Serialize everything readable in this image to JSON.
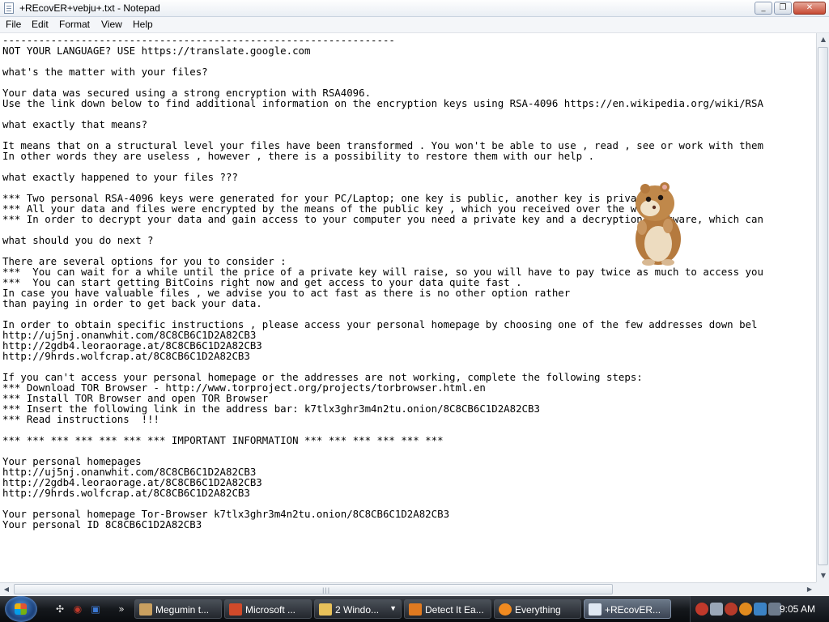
{
  "window": {
    "title": "+REcovER+vebju+.txt - Notepad",
    "minimize_glyph": "_",
    "maximize_glyph": "❐",
    "close_glyph": "✕"
  },
  "menu": [
    "File",
    "Edit",
    "Format",
    "View",
    "Help"
  ],
  "document": {
    "lines": [
      "-----------------------------------------------------------------",
      "NOT YOUR LANGUAGE? USE https://translate.google.com",
      "",
      "what's the matter with your files?",
      "",
      "Your data was secured using a strong encryption with RSA4096.",
      "Use the link down below to find additional information on the encryption keys using RSA-4096 https://en.wikipedia.org/wiki/RSA",
      "",
      "what exactly that means?",
      "",
      "It means that on a structural level your files have been transformed . You won't be able to use , read , see or work with them",
      "In other words they are useless , however , there is a possibility to restore them with our help .",
      "",
      "what exactly happened to your files ???",
      "",
      "*** Two personal RSA-4096 keys were generated for your PC/Laptop; one key is public, another key is private.",
      "*** All your data and files were encrypted by the means of the public key , which you received over the web .",
      "*** In order to decrypt your data and gain access to your computer you need a private key and a decryption software, which can",
      "",
      "what should you do next ?",
      "",
      "There are several options for you to consider :",
      "***  You can wait for a while until the price of a private key will raise, so you will have to pay twice as much to access you",
      "***  You can start getting BitCoins right now and get access to your data quite fast .",
      "In case you have valuable files , we advise you to act fast as there is no other option rather",
      "than paying in order to get back your data.",
      "",
      "In order to obtain specific instructions , please access your personal homepage by choosing one of the few addresses down bel",
      "http://uj5nj.onanwhit.com/8C8CB6C1D2A82CB3",
      "http://2gdb4.leoraorage.at/8C8CB6C1D2A82CB3",
      "http://9hrds.wolfcrap.at/8C8CB6C1D2A82CB3",
      "",
      "If you can't access your personal homepage or the addresses are not working, complete the following steps:",
      "*** Download TOR Browser - http://www.torproject.org/projects/torbrowser.html.en",
      "*** Install TOR Browser and open TOR Browser",
      "*** Insert the following link in the address bar: k7tlx3ghr3m4n2tu.onion/8C8CB6C1D2A82CB3",
      "*** Read instructions  !!!",
      "",
      "*** *** *** *** *** *** *** IMPORTANT INFORMATION *** *** *** *** *** ***",
      "",
      "Your personal homepages",
      "http://uj5nj.onanwhit.com/8C8CB6C1D2A82CB3",
      "http://2gdb4.leoraorage.at/8C8CB6C1D2A82CB3",
      "http://9hrds.wolfcrap.at/8C8CB6C1D2A82CB3",
      "",
      "Your personal homepage Tor-Browser k7tlx3ghr3m4n2tu.onion/8C8CB6C1D2A82CB3",
      "Your personal ID 8C8CB6C1D2A82CB3"
    ]
  },
  "taskbar": {
    "tasks": [
      {
        "label": "Megumin t...",
        "icon_color": "#c9a060",
        "icon": "game-icon"
      },
      {
        "label": "Microsoft ...",
        "icon_color": "#d04a2a",
        "icon": "office-icon"
      },
      {
        "label": "2 Windo...",
        "icon_color": "#e8c15a",
        "icon": "folder-icon"
      },
      {
        "label": "Detect It Ea...",
        "icon_color": "#e07a20",
        "icon": "detect-icon"
      },
      {
        "label": "Everything",
        "icon_color": "#f08a20",
        "icon": "search-icon"
      },
      {
        "label": "+REcovER...",
        "icon_color": "#dfe8f3",
        "icon": "notepad-icon"
      }
    ],
    "clock": "9:05 AM"
  }
}
